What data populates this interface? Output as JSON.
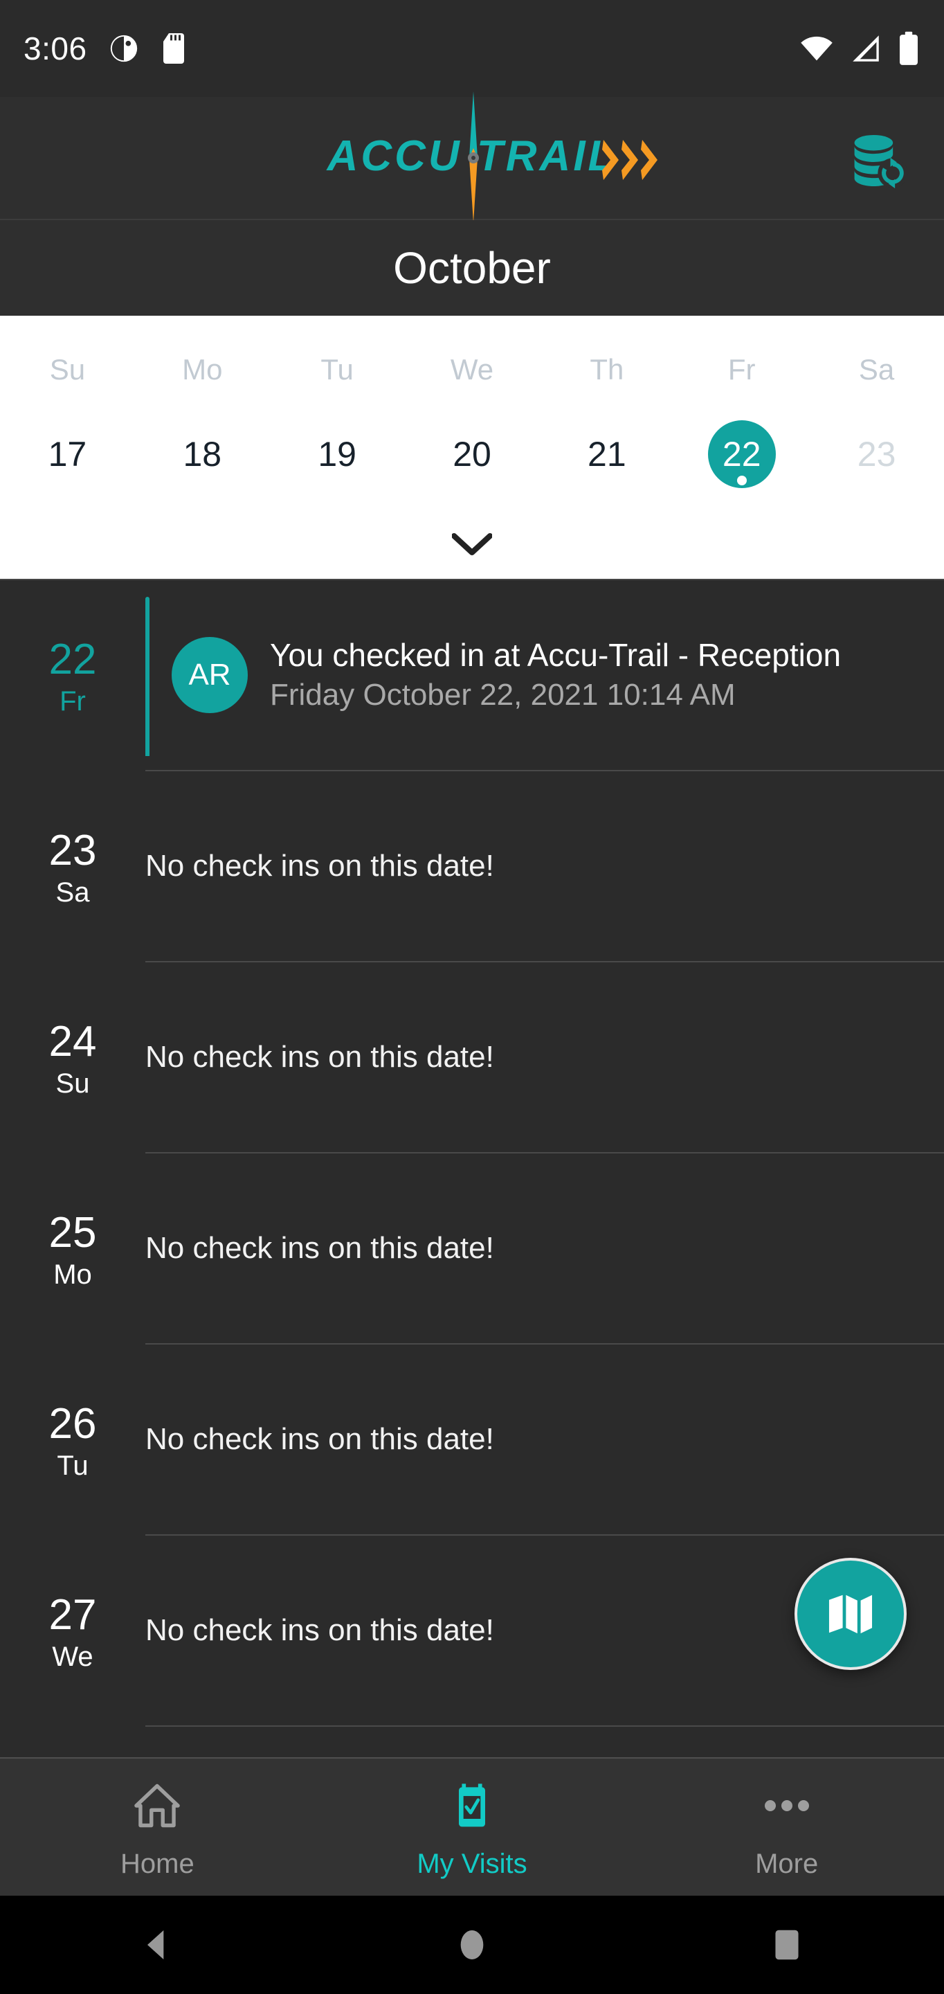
{
  "status_bar": {
    "clock": "3:06",
    "icons_left": [
      "do-not-disturb-icon",
      "sd-card-icon"
    ],
    "icons_right": [
      "wifi-icon",
      "cellular-signal-icon",
      "battery-icon"
    ]
  },
  "app_bar": {
    "logo_text": "ACCU TRAIL",
    "logo_colors": {
      "teal": "#14b3b0",
      "orange": "#f59a22"
    },
    "action_icon": "database-sync-icon"
  },
  "month_header": {
    "title": "October"
  },
  "calendar": {
    "weekday_labels": [
      "Su",
      "Mo",
      "Tu",
      "We",
      "Th",
      "Fr",
      "Sa"
    ],
    "days": [
      {
        "num": "17",
        "state": "normal"
      },
      {
        "num": "18",
        "state": "normal"
      },
      {
        "num": "19",
        "state": "normal"
      },
      {
        "num": "20",
        "state": "normal"
      },
      {
        "num": "21",
        "state": "normal"
      },
      {
        "num": "22",
        "state": "selected"
      },
      {
        "num": "23",
        "state": "muted"
      }
    ],
    "expand_icon": "chevron-down-icon",
    "selected_color": "#12a39f"
  },
  "agenda": {
    "rows": [
      {
        "day": "22",
        "dow": "Fr",
        "has_event": true,
        "avatar_initials": "AR",
        "event_title": "You checked in at Accu-Trail - Reception",
        "event_subtitle": "Friday October 22, 2021 10:14 AM"
      },
      {
        "day": "23",
        "dow": "Sa",
        "has_event": false,
        "empty_text": "No check ins on this date!"
      },
      {
        "day": "24",
        "dow": "Su",
        "has_event": false,
        "empty_text": "No check ins on this date!"
      },
      {
        "day": "25",
        "dow": "Mo",
        "has_event": false,
        "empty_text": "No check ins on this date!"
      },
      {
        "day": "26",
        "dow": "Tu",
        "has_event": false,
        "empty_text": "No check ins on this date!"
      },
      {
        "day": "27",
        "dow": "We",
        "has_event": false,
        "empty_text": "No check ins on this date!"
      }
    ]
  },
  "fab": {
    "icon": "map-icon",
    "color": "#12a39f"
  },
  "bottom_nav": {
    "items": [
      {
        "label": "Home",
        "icon": "home-icon",
        "active": false
      },
      {
        "label": "My Visits",
        "icon": "calendar-check-icon",
        "active": true
      },
      {
        "label": "More",
        "icon": "more-horizontal-icon",
        "active": false
      }
    ],
    "active_color": "#12cbc6"
  },
  "android_nav": {
    "buttons": [
      "back-button",
      "home-button",
      "recents-button"
    ]
  }
}
